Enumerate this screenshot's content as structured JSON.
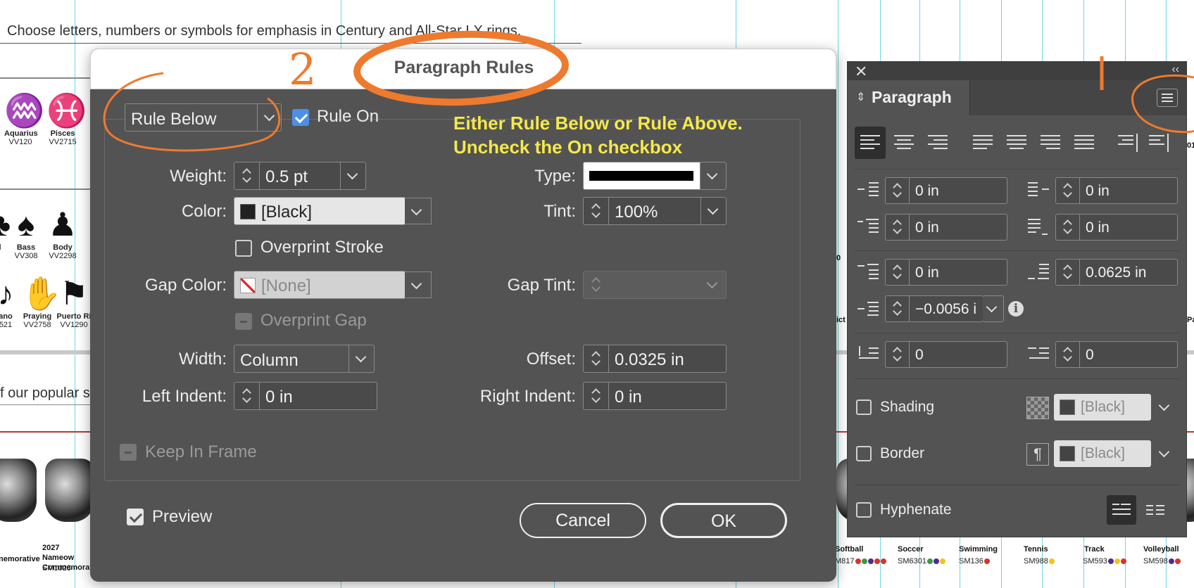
{
  "document": {
    "intro_text": "Choose letters, numbers or symbols for emphasis in Century and All-Star LX rings.",
    "fragment_text": "f our popular s",
    "top_icons": [
      {
        "name": "Aquarius",
        "code": "VV120",
        "glyph": "♒"
      },
      {
        "name": "Pisces",
        "code": "VV2715",
        "glyph": "♓"
      }
    ],
    "mid_icons": [
      {
        "name": "l",
        "code": "",
        "glyph": "♣"
      },
      {
        "name": "Bass",
        "code": "VV308",
        "glyph": "♠"
      },
      {
        "name": "Body",
        "code": "VV2298",
        "glyph": "♟"
      }
    ],
    "lower_icons": [
      {
        "name": "ano",
        "code": "521",
        "glyph": "♪"
      },
      {
        "name": "Praying",
        "code": "VV2758",
        "glyph": "✋"
      },
      {
        "name": "Puerto Ri",
        "code": "VV1290",
        "glyph": "⚑"
      }
    ],
    "rings_left": [
      {
        "name": "nemorative",
        "code": ""
      },
      {
        "name": "2027 Nameow Commemorat",
        "code": "SM1028"
      }
    ],
    "sports": [
      {
        "name": "Softball",
        "code": "M817",
        "dots": [
          "#d9332b",
          "#3a9b45",
          "#542a8c",
          "#d9332b",
          "#d9332b"
        ]
      },
      {
        "name": "Soccer",
        "code": "SM6301",
        "dots": [
          "#3a9b45",
          "#542a8c",
          "#f2c418"
        ]
      },
      {
        "name": "Swimming",
        "code": "SM136",
        "dots": [
          "#d9332b"
        ]
      },
      {
        "name": "Tennis",
        "code": "SM988",
        "dots": [
          "#f2c418"
        ]
      },
      {
        "name": "Track",
        "code": "SM593",
        "dots": [
          "#542a8c",
          "#f2c418",
          "#d9332b"
        ]
      },
      {
        "name": "Volleyball",
        "code": "SM598",
        "dots": [
          "#542a8c",
          "#d9332b"
        ]
      }
    ],
    "misc_labels": {
      "right_mid": "0",
      "right_lower": "ict",
      "right_edge_a": "Pa",
      "right_edge_b": "01"
    }
  },
  "dialog": {
    "title": "Paragraph Rules",
    "rule_type": "Rule Below",
    "rule_on_label": "Rule On",
    "rule_on_checked": true,
    "annotation_line1": "Either Rule Below or Rule Above.",
    "annotation_line2": "Uncheck the On checkbox",
    "weight_label": "Weight:",
    "weight_value": "0.5 pt",
    "type_label": "Type:",
    "color_label": "Color:",
    "color_value": "[Black]",
    "tint_label": "Tint:",
    "tint_value": "100%",
    "overprint_stroke_label": "Overprint Stroke",
    "gap_color_label": "Gap Color:",
    "gap_color_value": "[None]",
    "gap_tint_label": "Gap Tint:",
    "overprint_gap_label": "Overprint Gap",
    "width_label": "Width:",
    "width_value": "Column",
    "offset_label": "Offset:",
    "offset_value": "0.0325 in",
    "left_indent_label": "Left Indent:",
    "left_indent_value": "0 in",
    "right_indent_label": "Right Indent:",
    "right_indent_value": "0 in",
    "keep_in_frame_label": "Keep In Frame",
    "preview_label": "Preview",
    "cancel_label": "Cancel",
    "ok_label": "OK",
    "annotation_number": "2"
  },
  "panel": {
    "title": "Paragraph",
    "close_glyph": "✕",
    "collapse_glyph": "‹‹",
    "left_indent": "0 in",
    "right_indent": "0 in",
    "first_line_indent": "0 in",
    "last_line_indent": "0 in",
    "space_before": "0 in",
    "space_after": "0.0625 in",
    "space_between": "−0.0056 i",
    "drop_cap_lines": "0",
    "drop_cap_chars": "0",
    "shading_label": "Shading",
    "shading_color": "[Black]",
    "border_label": "Border",
    "border_color": "[Black]",
    "hyphenate_label": "Hyphenate",
    "info_glyph": "i"
  },
  "colors": {
    "annotation_orange": "#ee7a2e",
    "annotation_yellow": "#f5e94b",
    "dialog_bg": "#535353"
  }
}
